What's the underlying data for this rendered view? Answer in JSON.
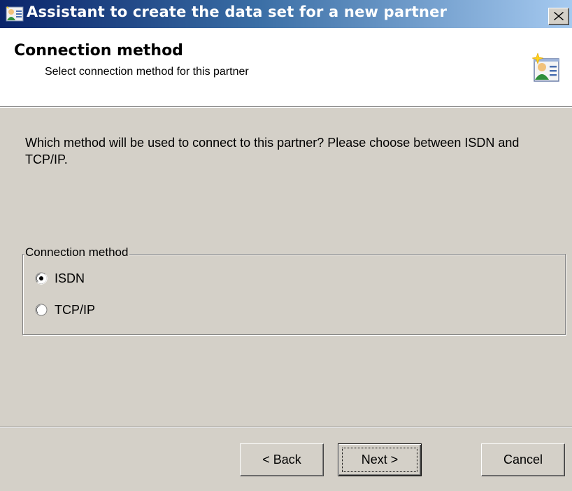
{
  "window": {
    "title": "Assistant to create the data set for a new partner",
    "app_icon": "wizard-card-icon",
    "close_icon": "close-icon"
  },
  "header": {
    "title": "Connection method",
    "subtitle": "Select connection method for this partner",
    "icon": "partner-card-sparkle-icon"
  },
  "body": {
    "question": "Which method will be used to connect to this partner? Please choose between ISDN and TCP/IP."
  },
  "group": {
    "legend": "Connection method",
    "options": [
      {
        "label": "ISDN",
        "selected": true
      },
      {
        "label": "TCP/IP",
        "selected": false
      }
    ]
  },
  "buttons": {
    "back": "< Back",
    "next": "Next >",
    "cancel": "Cancel",
    "default": "next"
  },
  "colors": {
    "dialog_bg": "#d4d0c8",
    "titlebar_start": "#0a246a",
    "titlebar_end": "#a6caf0",
    "header_bg": "#ffffff"
  }
}
